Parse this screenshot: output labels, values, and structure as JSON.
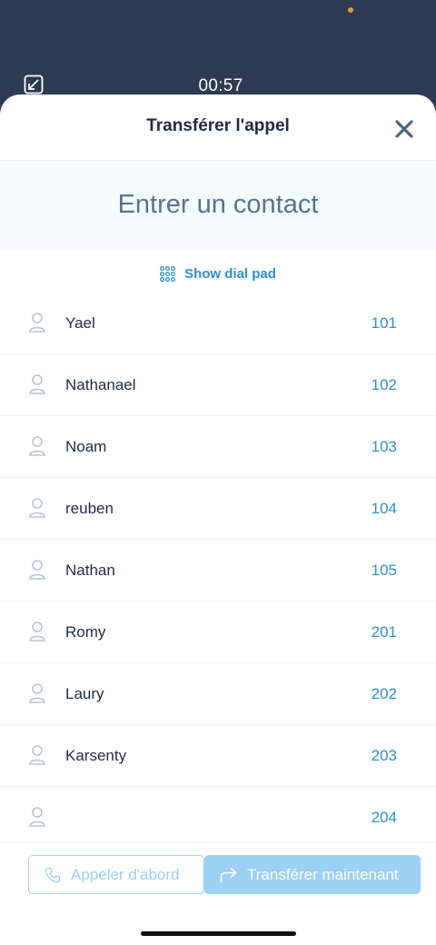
{
  "call": {
    "timer": "00:57",
    "minimize_icon": "minimize-icon"
  },
  "sheet": {
    "title": "Transférer l'appel",
    "close_icon": "close-icon"
  },
  "search": {
    "placeholder": "Entrer un contact",
    "value": ""
  },
  "dialpad": {
    "label": "Show dial pad",
    "icon": "dialpad-grid-icon"
  },
  "contacts": [
    {
      "name": "Yael",
      "ext": "101"
    },
    {
      "name": "Nathanael",
      "ext": "102"
    },
    {
      "name": "Noam",
      "ext": "103"
    },
    {
      "name": "reuben",
      "ext": "104"
    },
    {
      "name": "Nathan",
      "ext": "105"
    },
    {
      "name": "Romy",
      "ext": "201"
    },
    {
      "name": "Laury",
      "ext": "202"
    },
    {
      "name": "Karsenty",
      "ext": "203"
    },
    {
      "name": "",
      "ext": "204"
    }
  ],
  "footer": {
    "call_first_label": "Appeler d'abord",
    "transfer_now_label": "Transférer maintenant"
  },
  "colors": {
    "background": "#2e3a52",
    "accent": "#2b8fd0",
    "title": "#1f2a44",
    "status_dot": "#e39a2d",
    "transfer_button": "#9cd0f4"
  }
}
